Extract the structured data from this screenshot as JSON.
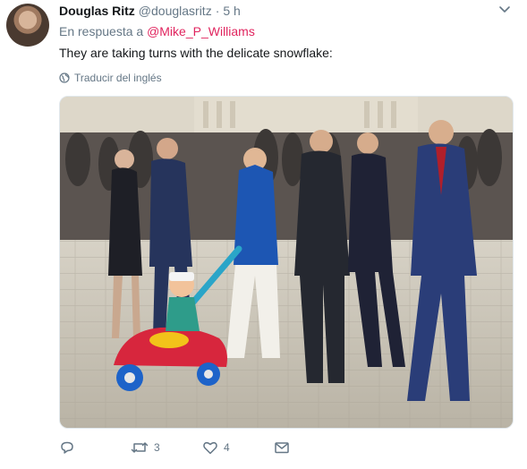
{
  "tweet": {
    "author_name": "Douglas Ritz",
    "author_handle": "@douglasritz",
    "separator": "·",
    "time": "5 h",
    "reply_prefix": "En respuesta a ",
    "reply_to": "@Mike_P_Williams",
    "text": "They are taking turns with the delicate snowflake:",
    "translate_label": "Traducir del inglés"
  },
  "actions": {
    "reply_count": "",
    "retweet_count": "3",
    "like_count": "4"
  },
  "icons": [
    "caret-down-icon",
    "globe-icon",
    "reply-icon",
    "retweet-icon",
    "heart-icon",
    "envelope-icon"
  ],
  "colors": {
    "mention": "#e0245e",
    "secondary_text": "#657786",
    "primary_text": "#14171a"
  }
}
